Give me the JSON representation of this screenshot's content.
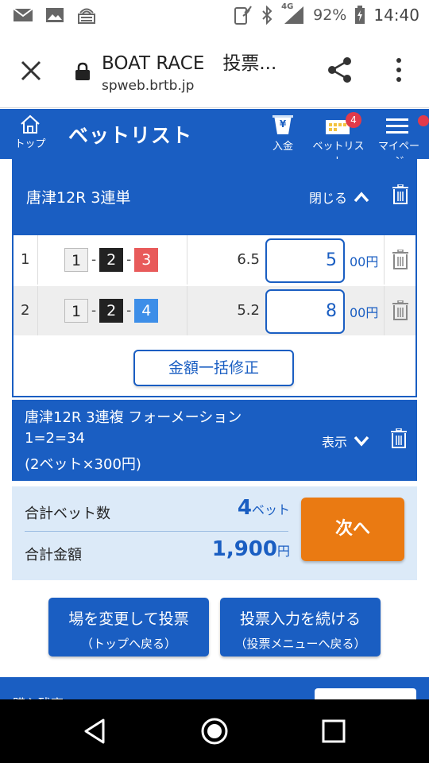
{
  "status_bar": {
    "battery_percent": "92%",
    "signal_label": "4G",
    "time": "14:40"
  },
  "browser": {
    "page_title": "BOAT RACE　投票...",
    "url": "spweb.brtb.jp"
  },
  "header": {
    "home_label": "トップ",
    "title": "ベットリスト",
    "nav": {
      "deposit_label": "入金",
      "betlist_label": "ベットリスト",
      "betlist_badge": "4",
      "mypage_label": "マイページ"
    }
  },
  "bet_group_1": {
    "title": "唐津12R 3連単",
    "close_label": "閉じる",
    "rows": [
      {
        "index": "1",
        "combo": [
          "1",
          "2",
          "3"
        ],
        "odds": "6.5",
        "amount": "5",
        "unit": "00円"
      },
      {
        "index": "2",
        "combo": [
          "1",
          "2",
          "4"
        ],
        "odds": "5.2",
        "amount": "8",
        "unit": "00円"
      }
    ],
    "bulk_edit_label": "金額一括修正"
  },
  "bet_group_2": {
    "title": "唐津12R 3連複 フォーメーション",
    "combo": "1=2=34",
    "detail": "(2ベット×300円)",
    "show_label": "表示"
  },
  "totals": {
    "bet_count_label": "合計ベット数",
    "bet_count_value": "4",
    "bet_count_unit": "ベット",
    "amount_label": "合計金額",
    "amount_value": "1,900",
    "amount_unit": "円",
    "next_label": "次へ"
  },
  "actions": {
    "change_venue_line1": "場を変更して投票",
    "change_venue_line2": "（トップへ戻る）",
    "continue_line1": "投票入力を続ける",
    "continue_line2": "（投票メニューへ戻る）"
  },
  "footer_peek": {
    "text": "購入残高"
  },
  "colors": {
    "primary_blue": "#1a5ec2",
    "next_orange": "#ea7a12",
    "badge_red": "#e23a4a",
    "totals_bg": "#dceaf8"
  }
}
